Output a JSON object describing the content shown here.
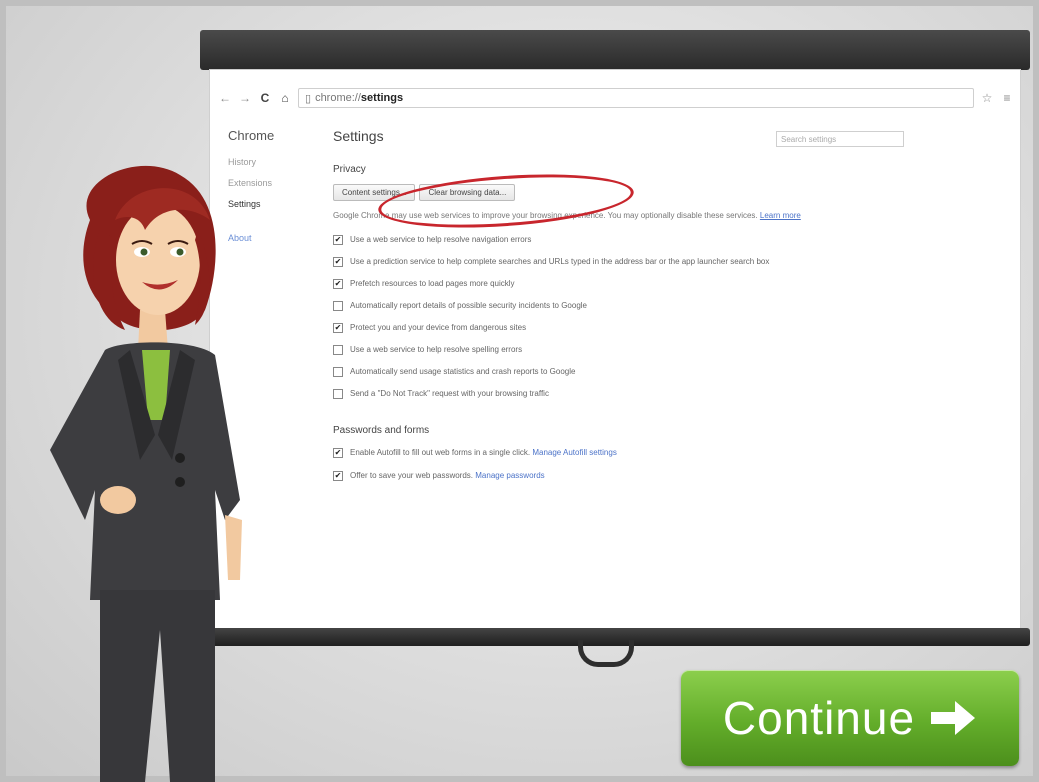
{
  "browser": {
    "address_prefix": "chrome://",
    "address_page": "settings"
  },
  "sidebar": {
    "brand": "Chrome",
    "items": [
      {
        "label": "History"
      },
      {
        "label": "Extensions"
      },
      {
        "label": "Settings"
      },
      {
        "label": "About"
      }
    ]
  },
  "settings": {
    "title": "Settings",
    "search_placeholder": "Search settings",
    "privacy": {
      "heading": "Privacy",
      "content_settings_label": "Content settings...",
      "clear_browsing_label": "Clear browsing data...",
      "description": "Google Chrome may use web services to improve your browsing experience. You may optionally disable these services.",
      "learn_more": "Learn more",
      "options": [
        {
          "label": "Use a web service to help resolve navigation errors",
          "checked": true
        },
        {
          "label": "Use a prediction service to help complete searches and URLs typed in the address bar or the app launcher search box",
          "checked": true
        },
        {
          "label": "Prefetch resources to load pages more quickly",
          "checked": true
        },
        {
          "label": "Automatically report details of possible security incidents to Google",
          "checked": false
        },
        {
          "label": "Protect you and your device from dangerous sites",
          "checked": true
        },
        {
          "label": "Use a web service to help resolve spelling errors",
          "checked": false
        },
        {
          "label": "Automatically send usage statistics and crash reports to Google",
          "checked": false
        },
        {
          "label": "Send a \"Do Not Track\" request with your browsing traffic",
          "checked": false
        }
      ]
    },
    "passwords": {
      "heading": "Passwords and forms",
      "autofill_label": "Enable Autofill to fill out web forms in a single click.",
      "autofill_link": "Manage Autofill settings",
      "autofill_checked": true,
      "passwords_label": "Offer to save your web passwords.",
      "passwords_link": "Manage passwords",
      "passwords_checked": true
    }
  },
  "continue_button": {
    "label": "Continue",
    "icon": "arrow-right-icon"
  },
  "colors": {
    "highlight": "#c8262d",
    "continue_green": "#63ad2a",
    "link_blue": "#4c73c8"
  }
}
